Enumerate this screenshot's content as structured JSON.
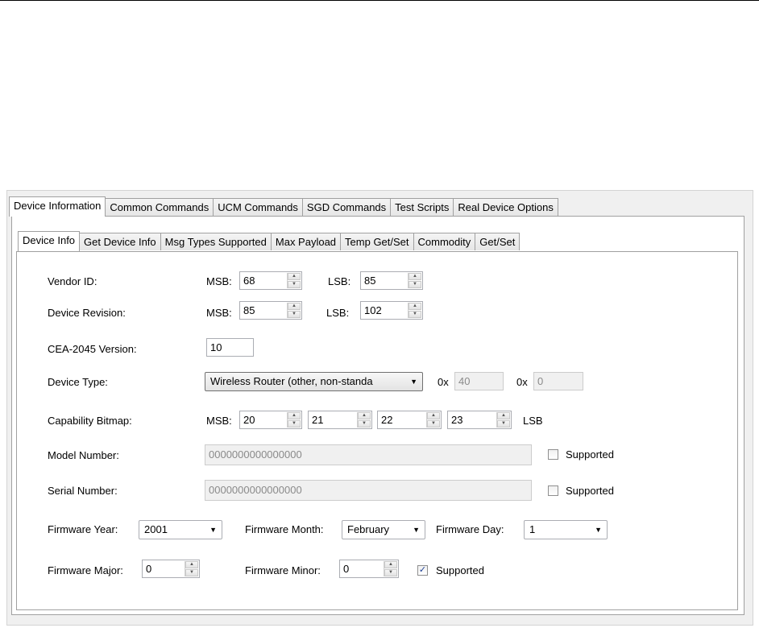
{
  "outer_tabs": [
    "Device Information",
    "Common Commands",
    "UCM Commands",
    "SGD Commands",
    "Test Scripts",
    "Real Device Options"
  ],
  "inner_tabs": [
    "Device Info",
    "Get Device Info",
    "Msg Types Supported",
    "Max Payload",
    "Temp Get/Set",
    "Commodity",
    "Get/Set"
  ],
  "vendor_id": {
    "label": "Vendor ID:",
    "msb_label": "MSB:",
    "msb": "68",
    "lsb_label": "LSB:",
    "lsb": "85"
  },
  "device_revision": {
    "label": "Device Revision:",
    "msb_label": "MSB:",
    "msb": "85",
    "lsb_label": "LSB:",
    "lsb": "102"
  },
  "cea_version": {
    "label": "CEA-2045 Version:",
    "value": "10"
  },
  "device_type": {
    "label": "Device Type:",
    "selected": "Wireless Router (other, non-standa",
    "hex1_prefix": "0x",
    "hex1": "40",
    "hex2_prefix": "0x",
    "hex2": "0"
  },
  "capability_bitmap": {
    "label": "Capability Bitmap:",
    "msb_label": "MSB:",
    "values": [
      "20",
      "21",
      "22",
      "23"
    ],
    "lsb_label": "LSB"
  },
  "model_number": {
    "label": "Model Number:",
    "value": "0000000000000000",
    "supported_label": "Supported",
    "supported": false
  },
  "serial_number": {
    "label": "Serial Number:",
    "value": "0000000000000000",
    "supported_label": "Supported",
    "supported": false
  },
  "firmware": {
    "year_label": "Firmware Year:",
    "year": "2001",
    "month_label": "Firmware Month:",
    "month": "February",
    "day_label": "Firmware Day:",
    "day": "1",
    "major_label": "Firmware Major:",
    "major": "0",
    "minor_label": "Firmware Minor:",
    "minor": "0",
    "supported_label": "Supported",
    "supported": true
  },
  "icons": {
    "spin_up": "▲",
    "spin_down": "▼",
    "dropdown": "▼",
    "check": "✓"
  }
}
